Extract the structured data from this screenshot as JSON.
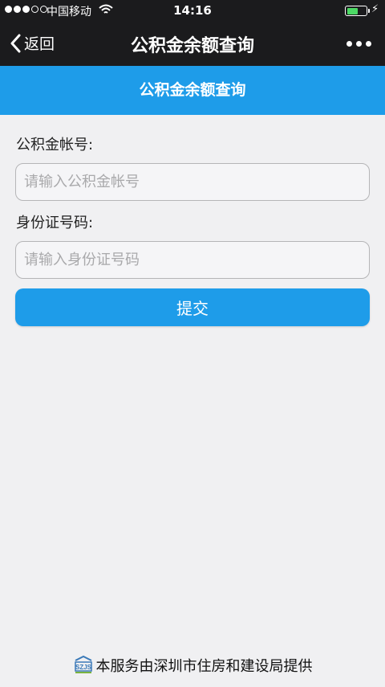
{
  "status_bar": {
    "carrier": "中国移动",
    "time": "14:16",
    "signal_bars_filled": 3,
    "signal_bars_total": 5,
    "battery_level": 0.6
  },
  "nav": {
    "back_label": "返回",
    "title": "公积金余额查询"
  },
  "banner": {
    "title": "公积金余额查询"
  },
  "form": {
    "account_label": "公积金帐号:",
    "account_placeholder": "请输入公积金帐号",
    "id_label": "身份证号码:",
    "id_placeholder": "请输入身份证号码",
    "submit_label": "提交"
  },
  "footer": {
    "text": "本服务由深圳市住房和建设局提供"
  },
  "colors": {
    "accent": "#1e9ce9",
    "bar_bg": "#1b1b1d",
    "page_bg": "#f0f0f2"
  }
}
